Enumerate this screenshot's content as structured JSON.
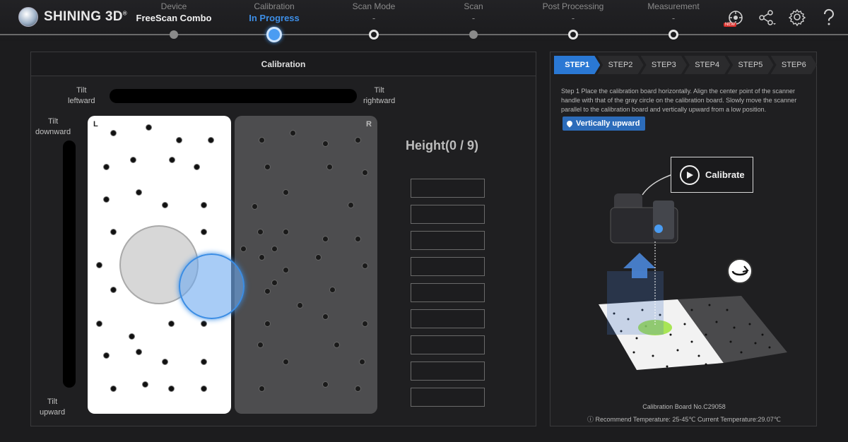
{
  "brand": {
    "name": "SHINING 3D",
    "trademark": "®"
  },
  "stages": [
    {
      "name": "Device",
      "value": "FreeScan Combo",
      "state": "done"
    },
    {
      "name": "Calibration",
      "value": "In Progress",
      "state": "active"
    },
    {
      "name": "Scan Mode",
      "value": "-",
      "state": "pending"
    },
    {
      "name": "Scan",
      "value": "-",
      "state": "pending"
    },
    {
      "name": "Post Processing",
      "value": "-",
      "state": "pending"
    },
    {
      "name": "Measurement",
      "value": "-",
      "state": "pending"
    }
  ],
  "toolbar": {
    "new_badge": "NEW",
    "icons": [
      "device-new-icon",
      "share-icon",
      "settings-icon",
      "help-icon"
    ]
  },
  "calibration": {
    "title": "Calibration",
    "tilt_leftward": "Tilt\nleftward",
    "tilt_rightward": "Tilt\nrightward",
    "tilt_downward": "Tilt\ndownward",
    "tilt_upward": "Tilt\nupward",
    "board_left_tag": "L",
    "board_right_tag": "R",
    "height_label": "Height(0 / 9)",
    "height_done": 0,
    "height_total": 9
  },
  "guide": {
    "steps": [
      "STEP1",
      "STEP2",
      "STEP3",
      "STEP4",
      "STEP5",
      "STEP6"
    ],
    "active_step": "STEP1",
    "instruction": "Step 1 Place the calibration board horizontally. Align the center point of the scanner handle with that of the gray circle on the calibration board. Slowly move the scanner parallel to the calibration board and vertically upward from a low position.",
    "direction_badge": "Vertically upward",
    "calibrate_button": "Calibrate",
    "board_number": "Calibration Board No.C29058",
    "temperature": "Recommend Temperature: 25-45℃ Current Temperature:29.07℃"
  },
  "colors": {
    "accent": "#2a78d4",
    "active_stage": "#3d8ee6",
    "board_white": "#ffffff",
    "board_dark": "#4d4d4f"
  }
}
